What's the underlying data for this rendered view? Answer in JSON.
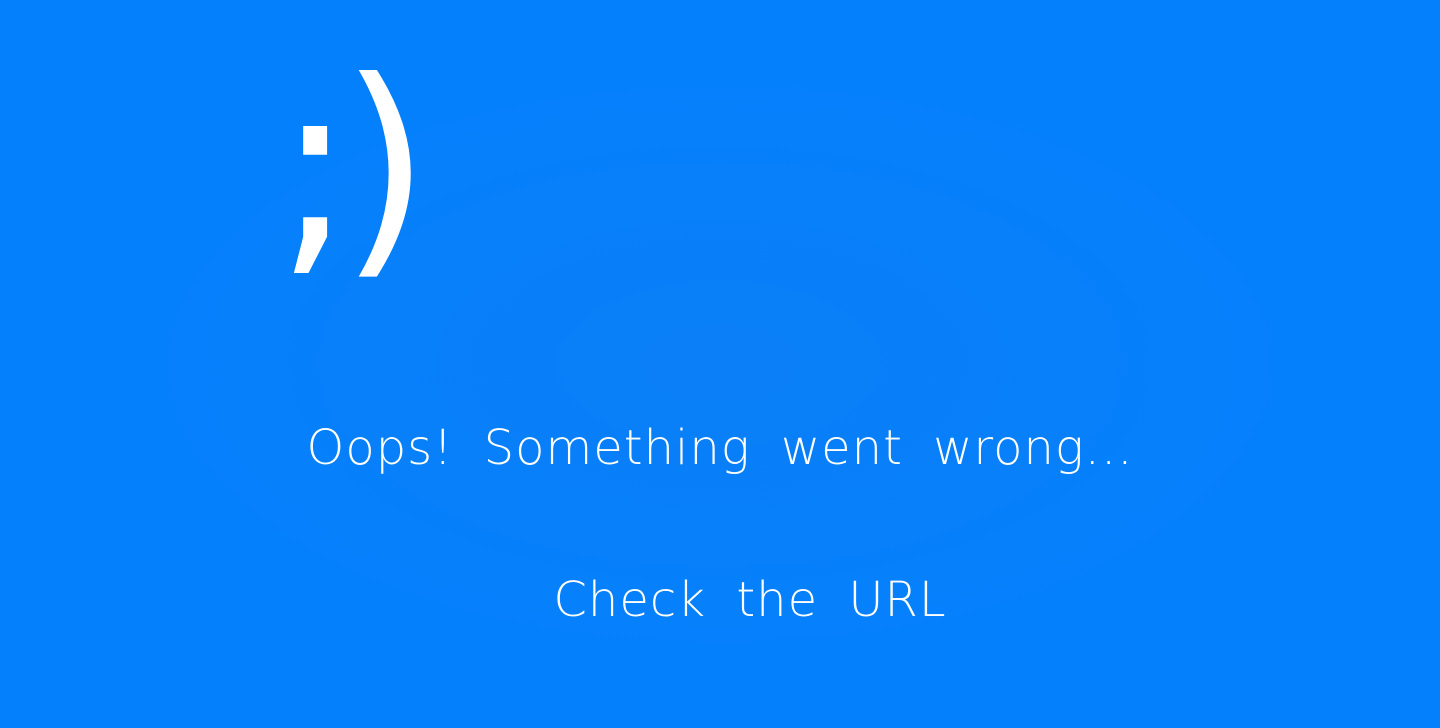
{
  "emoticon": ";)",
  "message": "Oops! Something went wrong...",
  "hint": "Check the URL",
  "colors": {
    "background": "#0480fd",
    "text": "#ffffff"
  }
}
